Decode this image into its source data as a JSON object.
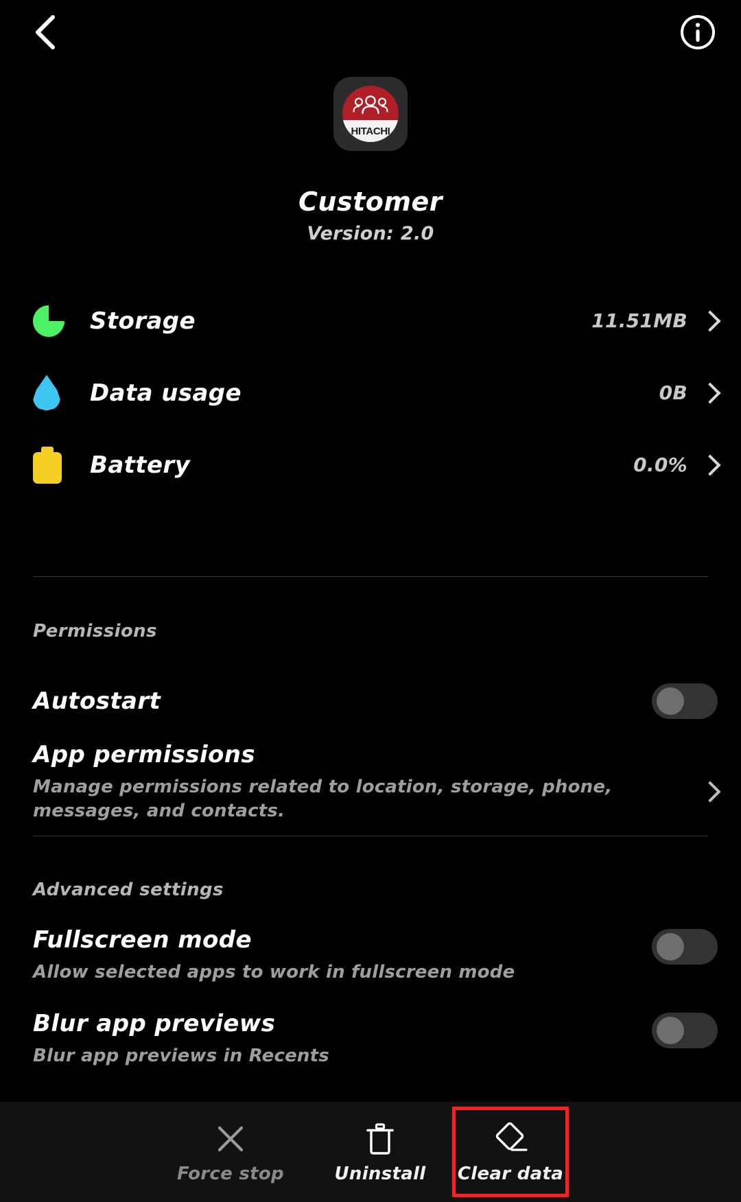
{
  "topbar": {
    "back_icon": "chevron-left-icon",
    "info_icon": "info-circle-icon"
  },
  "app": {
    "icon": {
      "name": "app-icon-hitachi-customer",
      "brand_text": "HITACHI",
      "circle_color": "#b01f26",
      "band_color": "#f2f2f2",
      "tile_color": "#2c2c2e",
      "glyph": "people-icon"
    },
    "title": "Customer",
    "version": "Version: 2.0"
  },
  "info_rows": [
    {
      "icon": "pie-chart-icon",
      "icon_color": "#4df264",
      "label": "Storage",
      "value": "11.51MB"
    },
    {
      "icon": "water-drop-icon",
      "icon_color": "#3fc6f0",
      "label": "Data usage",
      "value": "0B"
    },
    {
      "icon": "battery-icon",
      "icon_color": "#f5cf24",
      "label": "Battery",
      "value": "0.0%"
    }
  ],
  "permissions": {
    "header": "Permissions",
    "autostart": {
      "title": "Autostart",
      "toggle_state": "off"
    },
    "app_permissions": {
      "title": "App permissions",
      "description": "Manage permissions related to location, storage, phone, messages, and contacts."
    }
  },
  "advanced": {
    "header": "Advanced settings",
    "fullscreen": {
      "title": "Fullscreen mode",
      "description": "Allow selected apps to work in fullscreen mode",
      "toggle_state": "off"
    },
    "blur_previews": {
      "title": "Blur app previews",
      "description": "Blur app previews in Recents",
      "toggle_state": "off"
    }
  },
  "bottom_bar": {
    "force_stop": {
      "label": "Force stop",
      "icon": "close-x-icon",
      "enabled": "false"
    },
    "uninstall": {
      "label": "Uninstall",
      "icon": "trash-icon",
      "enabled": "true"
    },
    "clear_data": {
      "label": "Clear data",
      "icon": "eraser-icon",
      "enabled": "true",
      "highlight_color": "#ff1f1f"
    }
  }
}
